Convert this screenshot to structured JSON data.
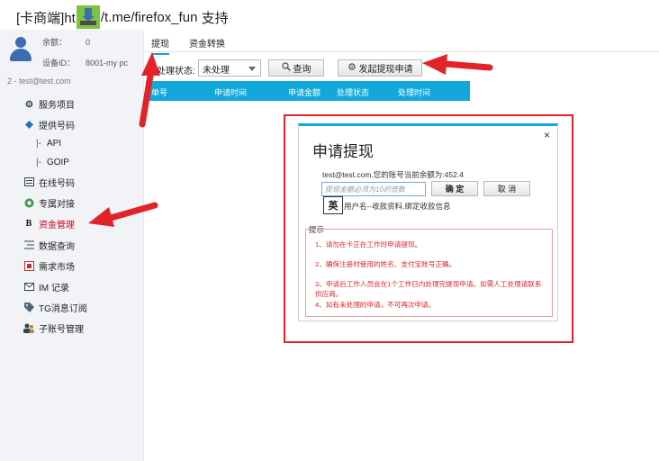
{
  "banner": {
    "prefix": "[卡商端]ht",
    "suffix": "/t.me/firefox_fun",
    "support": "支持",
    "icon": "download-icon"
  },
  "account": {
    "balance_label": "余额：",
    "balance_value": "0",
    "device_label": "设备ID：",
    "device_value": "8001-my pc",
    "user": "2 - test@test.com"
  },
  "menu": [
    {
      "label": "服务项目",
      "icon": "settings-icon"
    },
    {
      "label": "提供号码",
      "icon": "diamond-icon"
    },
    {
      "label": "API",
      "prefix": "|-"
    },
    {
      "label": "GOIP",
      "prefix": "|-"
    },
    {
      "label": "在线号码",
      "icon": "list-icon"
    },
    {
      "label": "专属对接",
      "icon": "link-icon"
    },
    {
      "label": "资金管理",
      "icon": "bold-b-icon"
    },
    {
      "label": "数据查询",
      "icon": "list-lines-icon"
    },
    {
      "label": "需求市场",
      "icon": "market-icon"
    },
    {
      "label": "IM 记录",
      "icon": "mail-icon"
    },
    {
      "label": "TG消息订阅",
      "icon": "tag-icon"
    },
    {
      "label": "子账号管理",
      "icon": "users-icon"
    }
  ],
  "tabs": [
    {
      "label": "提现"
    },
    {
      "label": "资金转换"
    }
  ],
  "toolbar": {
    "status_label": "处理状态:",
    "status_value": "未处理",
    "query_label": "查询",
    "withdraw_request_label": "发起提现申请"
  },
  "table": {
    "headers": [
      "单号",
      "申请时间",
      "申请金额",
      "处理状态",
      "处理时间"
    ]
  },
  "modal": {
    "title": "申请提现",
    "close": "×",
    "balance_line": "test@test.com.您的账号当前余额为:452.4",
    "amount_placeholder": "提现金额必须为10的倍数",
    "ok_label": "确 定",
    "cancel_label": "取 消",
    "ime_label": "英",
    "receive_line": "用户名--收款资料.绑定收款信息",
    "hint_title": "提示",
    "hints": [
      "1、请勿在卡正在工作时申请提现。",
      "2、确保注册时使用的姓名、支付宝账号正确。",
      "3、申请后工作人员会在1个工作日内处理完提现申请。如需人工处理请联系供应商。",
      "4、如有未处理的申请，不可再次申请。"
    ]
  },
  "colors": {
    "accent": "#12a8d9",
    "annotation_red": "#e0242a",
    "active_menu": "#d0021b"
  }
}
